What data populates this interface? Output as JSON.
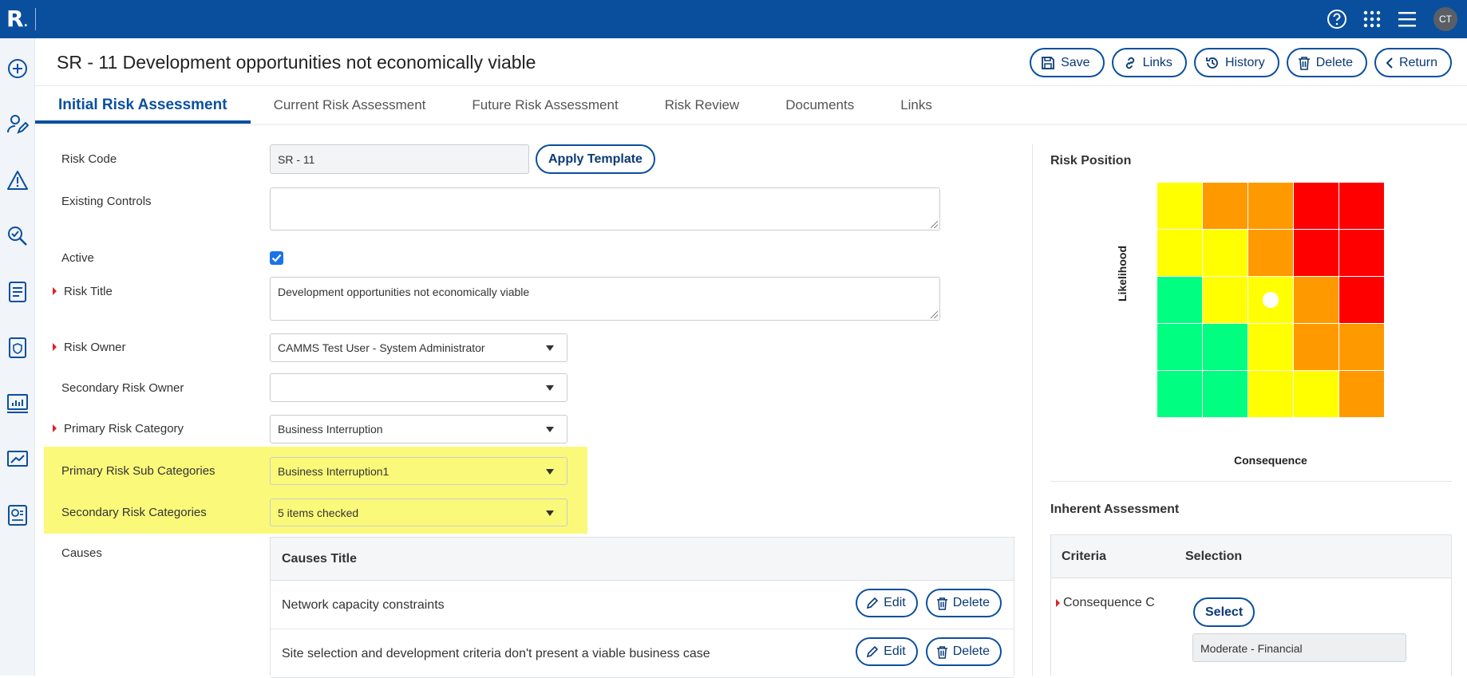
{
  "app": {
    "logo": "R",
    "logo_dot": "."
  },
  "topbar": {
    "avatar_initials": "CT"
  },
  "page": {
    "title": "SR - 11 Development opportunities not economically viable"
  },
  "actions": {
    "save": "Save",
    "links": "Links",
    "history": "History",
    "delete": "Delete",
    "return": "Return"
  },
  "tabs": [
    {
      "label": "Initial Risk Assessment",
      "active": true
    },
    {
      "label": "Current Risk Assessment"
    },
    {
      "label": "Future Risk Assessment"
    },
    {
      "label": "Risk Review"
    },
    {
      "label": "Documents"
    },
    {
      "label": "Links"
    }
  ],
  "form": {
    "risk_code": {
      "label": "Risk Code",
      "value": "SR - 11"
    },
    "apply_template": "Apply Template",
    "existing_controls": {
      "label": "Existing Controls",
      "value": ""
    },
    "active": {
      "label": "Active",
      "checked": true
    },
    "risk_title": {
      "label": "Risk Title",
      "value": "Development opportunities not economically viable"
    },
    "risk_owner": {
      "label": "Risk Owner",
      "value": "CAMMS Test User - System Administrator"
    },
    "secondary_risk_owner": {
      "label": "Secondary Risk Owner",
      "value": ""
    },
    "primary_risk_category": {
      "label": "Primary Risk Category",
      "value": "Business Interruption"
    },
    "primary_risk_sub_categories": {
      "label": "Primary Risk Sub Categories",
      "value": "Business Interruption1"
    },
    "secondary_risk_categories": {
      "label": "Secondary Risk Categories",
      "value": "5 items checked"
    },
    "causes": {
      "label": "Causes",
      "header": "Causes Title",
      "edit_label": "Edit",
      "delete_label": "Delete",
      "rows": [
        "Network capacity constraints",
        "Site selection and development criteria don't present a viable business case"
      ]
    }
  },
  "risk_position": {
    "title": "Risk Position",
    "y_label": "Likelihood",
    "x_label": "Consequence",
    "grid": [
      [
        "#ffff00",
        "#ff9900",
        "#ff9900",
        "#ff0000",
        "#ff0000"
      ],
      [
        "#ffff00",
        "#ffff00",
        "#ff9900",
        "#ff0000",
        "#ff0000"
      ],
      [
        "#00ff80",
        "#ffff00",
        "#ffff00",
        "#ff9900",
        "#ff0000"
      ],
      [
        "#00ff80",
        "#00ff80",
        "#ffff00",
        "#ff9900",
        "#ff9900"
      ],
      [
        "#00ff80",
        "#00ff80",
        "#ffff00",
        "#ffff00",
        "#ff9900"
      ]
    ],
    "marker_row": 3,
    "marker_col": 3
  },
  "inherent": {
    "title": "Inherent Assessment",
    "col_criteria": "Criteria",
    "col_selection": "Selection",
    "row_label": "Consequence C",
    "select_label": "Select",
    "selected_value": "Moderate - Financial"
  },
  "colors": {
    "brand": "#0a4f9e",
    "highlight": "#fbf97a",
    "required": "#e0202a"
  }
}
